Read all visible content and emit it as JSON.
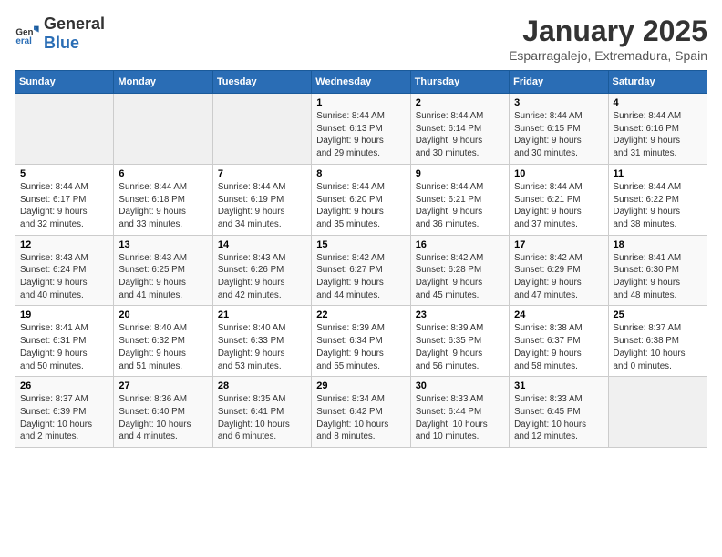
{
  "logo": {
    "general": "General",
    "blue": "Blue"
  },
  "title": {
    "month": "January 2025",
    "location": "Esparragalejo, Extremadura, Spain"
  },
  "weekdays": [
    "Sunday",
    "Monday",
    "Tuesday",
    "Wednesday",
    "Thursday",
    "Friday",
    "Saturday"
  ],
  "weeks": [
    [
      {
        "day": "",
        "info": ""
      },
      {
        "day": "",
        "info": ""
      },
      {
        "day": "",
        "info": ""
      },
      {
        "day": "1",
        "info": "Sunrise: 8:44 AM\nSunset: 6:13 PM\nDaylight: 9 hours\nand 29 minutes."
      },
      {
        "day": "2",
        "info": "Sunrise: 8:44 AM\nSunset: 6:14 PM\nDaylight: 9 hours\nand 30 minutes."
      },
      {
        "day": "3",
        "info": "Sunrise: 8:44 AM\nSunset: 6:15 PM\nDaylight: 9 hours\nand 30 minutes."
      },
      {
        "day": "4",
        "info": "Sunrise: 8:44 AM\nSunset: 6:16 PM\nDaylight: 9 hours\nand 31 minutes."
      }
    ],
    [
      {
        "day": "5",
        "info": "Sunrise: 8:44 AM\nSunset: 6:17 PM\nDaylight: 9 hours\nand 32 minutes."
      },
      {
        "day": "6",
        "info": "Sunrise: 8:44 AM\nSunset: 6:18 PM\nDaylight: 9 hours\nand 33 minutes."
      },
      {
        "day": "7",
        "info": "Sunrise: 8:44 AM\nSunset: 6:19 PM\nDaylight: 9 hours\nand 34 minutes."
      },
      {
        "day": "8",
        "info": "Sunrise: 8:44 AM\nSunset: 6:20 PM\nDaylight: 9 hours\nand 35 minutes."
      },
      {
        "day": "9",
        "info": "Sunrise: 8:44 AM\nSunset: 6:21 PM\nDaylight: 9 hours\nand 36 minutes."
      },
      {
        "day": "10",
        "info": "Sunrise: 8:44 AM\nSunset: 6:21 PM\nDaylight: 9 hours\nand 37 minutes."
      },
      {
        "day": "11",
        "info": "Sunrise: 8:44 AM\nSunset: 6:22 PM\nDaylight: 9 hours\nand 38 minutes."
      }
    ],
    [
      {
        "day": "12",
        "info": "Sunrise: 8:43 AM\nSunset: 6:24 PM\nDaylight: 9 hours\nand 40 minutes."
      },
      {
        "day": "13",
        "info": "Sunrise: 8:43 AM\nSunset: 6:25 PM\nDaylight: 9 hours\nand 41 minutes."
      },
      {
        "day": "14",
        "info": "Sunrise: 8:43 AM\nSunset: 6:26 PM\nDaylight: 9 hours\nand 42 minutes."
      },
      {
        "day": "15",
        "info": "Sunrise: 8:42 AM\nSunset: 6:27 PM\nDaylight: 9 hours\nand 44 minutes."
      },
      {
        "day": "16",
        "info": "Sunrise: 8:42 AM\nSunset: 6:28 PM\nDaylight: 9 hours\nand 45 minutes."
      },
      {
        "day": "17",
        "info": "Sunrise: 8:42 AM\nSunset: 6:29 PM\nDaylight: 9 hours\nand 47 minutes."
      },
      {
        "day": "18",
        "info": "Sunrise: 8:41 AM\nSunset: 6:30 PM\nDaylight: 9 hours\nand 48 minutes."
      }
    ],
    [
      {
        "day": "19",
        "info": "Sunrise: 8:41 AM\nSunset: 6:31 PM\nDaylight: 9 hours\nand 50 minutes."
      },
      {
        "day": "20",
        "info": "Sunrise: 8:40 AM\nSunset: 6:32 PM\nDaylight: 9 hours\nand 51 minutes."
      },
      {
        "day": "21",
        "info": "Sunrise: 8:40 AM\nSunset: 6:33 PM\nDaylight: 9 hours\nand 53 minutes."
      },
      {
        "day": "22",
        "info": "Sunrise: 8:39 AM\nSunset: 6:34 PM\nDaylight: 9 hours\nand 55 minutes."
      },
      {
        "day": "23",
        "info": "Sunrise: 8:39 AM\nSunset: 6:35 PM\nDaylight: 9 hours\nand 56 minutes."
      },
      {
        "day": "24",
        "info": "Sunrise: 8:38 AM\nSunset: 6:37 PM\nDaylight: 9 hours\nand 58 minutes."
      },
      {
        "day": "25",
        "info": "Sunrise: 8:37 AM\nSunset: 6:38 PM\nDaylight: 10 hours\nand 0 minutes."
      }
    ],
    [
      {
        "day": "26",
        "info": "Sunrise: 8:37 AM\nSunset: 6:39 PM\nDaylight: 10 hours\nand 2 minutes."
      },
      {
        "day": "27",
        "info": "Sunrise: 8:36 AM\nSunset: 6:40 PM\nDaylight: 10 hours\nand 4 minutes."
      },
      {
        "day": "28",
        "info": "Sunrise: 8:35 AM\nSunset: 6:41 PM\nDaylight: 10 hours\nand 6 minutes."
      },
      {
        "day": "29",
        "info": "Sunrise: 8:34 AM\nSunset: 6:42 PM\nDaylight: 10 hours\nand 8 minutes."
      },
      {
        "day": "30",
        "info": "Sunrise: 8:33 AM\nSunset: 6:44 PM\nDaylight: 10 hours\nand 10 minutes."
      },
      {
        "day": "31",
        "info": "Sunrise: 8:33 AM\nSunset: 6:45 PM\nDaylight: 10 hours\nand 12 minutes."
      },
      {
        "day": "",
        "info": ""
      }
    ]
  ]
}
